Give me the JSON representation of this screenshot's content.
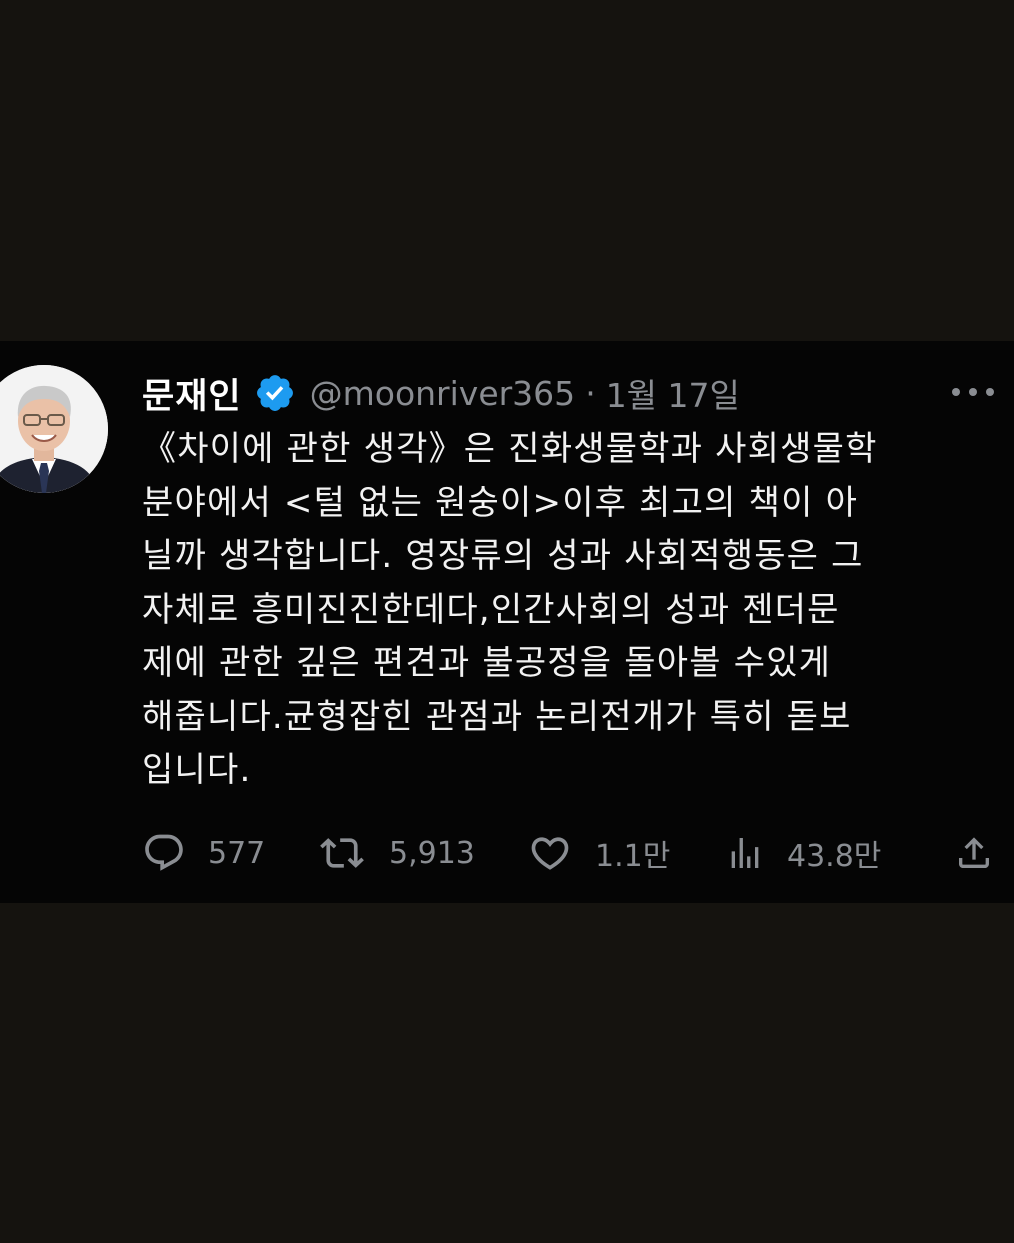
{
  "tweet": {
    "author": {
      "display_name": "문재인",
      "handle": "@moonriver365",
      "verified": true
    },
    "separator": "·",
    "date": "1월 17일",
    "body_lines": [
      "《차이에 관한 생각》은 진화생물학과 사회생물학",
      "분야에서 <털 없는 원숭이>이후 최고의 책이 아",
      "닐까 생각합니다. 영장류의 성과 사회적행동은 그",
      "자체로 흥미진진한데다,인간사회의 성과 젠더문",
      "제에 관한 깊은 편견과 불공정을 돌아볼 수있게",
      "해줍니다.균형잡힌 관점과 논리전개가 특히 돋보",
      "입니다."
    ],
    "metrics": {
      "replies": "577",
      "retweets": "5,913",
      "likes": "1.1만",
      "views": "43.8만"
    }
  },
  "icons": {
    "verified": "verified-badge-icon",
    "more": "more-dots-icon",
    "reply": "reply-bubble-icon",
    "retweet": "retweet-icon",
    "like": "heart-icon",
    "views": "views-bar-chart-icon",
    "share": "share-upload-icon"
  },
  "colors": {
    "page_background": "#15130f",
    "tweet_background": "#050505",
    "text_primary": "#f2f2f2",
    "text_secondary": "#8a8d92",
    "verified_blue": "#1d9bf0"
  }
}
